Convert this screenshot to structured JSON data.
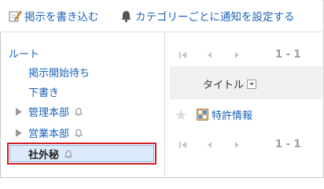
{
  "toolbar": {
    "post_label": "掲示を書き込む",
    "notify_label": "カテゴリーごとに通知を設定する"
  },
  "sidebar": {
    "root": "ルート",
    "items": [
      {
        "label": "掲示開始待ち"
      },
      {
        "label": "下書き"
      },
      {
        "label": "管理本部"
      },
      {
        "label": "営業本部"
      },
      {
        "label": "社外秘"
      }
    ]
  },
  "main": {
    "pager_top": "1 - 1",
    "pager_bottom": "1 - 1",
    "column_title": "タイトル",
    "rows": [
      {
        "title": "特許情報"
      }
    ]
  }
}
